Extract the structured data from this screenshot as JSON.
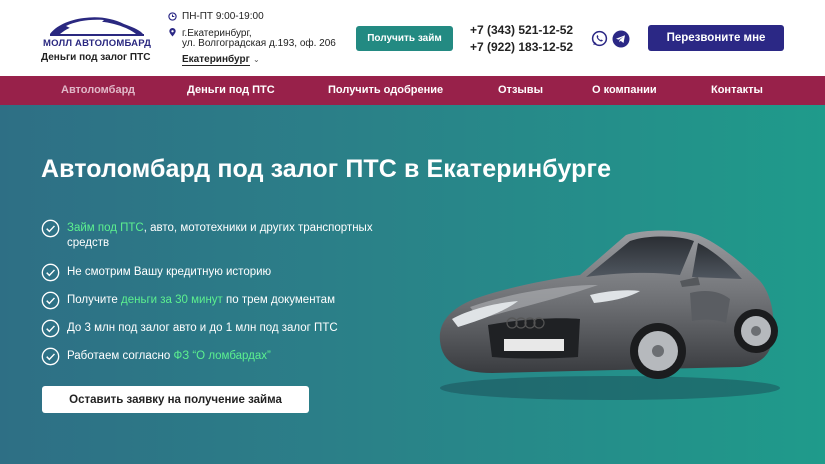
{
  "header": {
    "logo": {
      "name": "МОЛЛ АВТОЛОМБАРД",
      "tagline": "Деньги под залог ПТС"
    },
    "hours": "ПН-ПТ 9:00-19:00",
    "address_line1": "г.Екатеринбург,",
    "address_line2": "ул. Волгоградская д.193, оф. 206",
    "city": "Екатеринбург",
    "get_loan_button": "Получить займ",
    "phones": [
      "+7 (343) 521-12-52",
      "+7 (922) 183-12-52"
    ],
    "callback_button": "Перезвоните мне"
  },
  "nav": {
    "items": [
      {
        "label": "Автоломбард",
        "active": true
      },
      {
        "label": "Деньги под ПТС",
        "active": false
      },
      {
        "label": "Получить одобрение",
        "active": false
      },
      {
        "label": "Отзывы",
        "active": false
      },
      {
        "label": "О компании",
        "active": false
      },
      {
        "label": "Контакты",
        "active": false
      }
    ]
  },
  "hero": {
    "title": "Автоломбард под залог ПТС в Екатеринбурге",
    "features": [
      {
        "highlight": "Займ под ПТС",
        "text": ", авто, мототехники и других транспортных средств"
      },
      {
        "before": "Не смотрим Вашу кредитную историю"
      },
      {
        "before": "Получите ",
        "highlight": "деньги за 30 минут",
        "after": " по трем документам"
      },
      {
        "before": "До 3 млн под залог авто и до 1 млн под залог ПТС"
      },
      {
        "before": "Работаем согласно ",
        "highlight": "ФЗ “О ломбардах”"
      }
    ],
    "apply_button": "Оставить заявку на получение займа"
  },
  "colors": {
    "brand_blue": "#2b2885",
    "teal_button": "#238a82",
    "nav_bg": "#98214a",
    "highlight_green": "#5cf08f"
  },
  "icons": [
    "clock-icon",
    "location-pin-icon",
    "chevron-down-icon",
    "whatsapp-icon",
    "telegram-icon",
    "check-circle-icon",
    "logo-car-icon",
    "sports-car-image"
  ]
}
